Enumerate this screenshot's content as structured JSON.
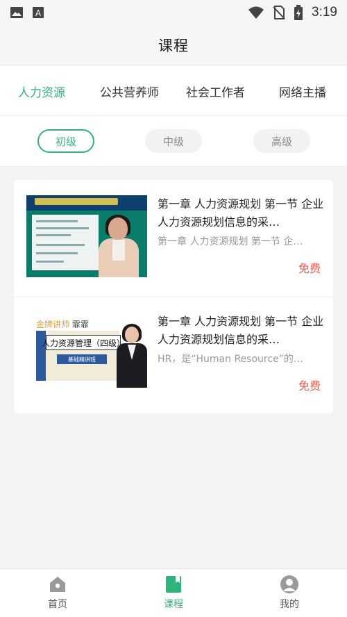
{
  "status_bar": {
    "time": "3:19",
    "left_icons": [
      "image-icon",
      "font-a-icon"
    ],
    "right_icons": [
      "wifi-icon",
      "no-sim-icon",
      "battery-charging-icon"
    ]
  },
  "header": {
    "title": "课程"
  },
  "categories": [
    {
      "label": "人力资源",
      "active": true
    },
    {
      "label": "公共营养师",
      "active": false
    },
    {
      "label": "社会工作者",
      "active": false
    },
    {
      "label": "网络主播",
      "active": false
    }
  ],
  "levels": [
    {
      "label": "初级",
      "active": true
    },
    {
      "label": "中级",
      "active": false
    },
    {
      "label": "高级",
      "active": false
    }
  ],
  "courses": [
    {
      "title": "第一章 人力资源规划 第一节 企业人力资源规划信息的采…",
      "description": "第一章 人力资源规划 第一节 企…",
      "price": "免费",
      "thumbnail": "classroom-video-thumbnail"
    },
    {
      "title": "第一章 人力资源规划 第一节 企业人力资源规划信息的采…",
      "description": "HR，是“Human Resource”的…",
      "price": "免费",
      "thumbnail": "course-poster-thumbnail",
      "poster": {
        "brand": "金牌讲师",
        "teacher": "霏霏",
        "book_title": "人力资源管理（四级）",
        "tag": "基础精讲班"
      }
    }
  ],
  "bottom_nav": [
    {
      "label": "首页",
      "icon": "home-icon",
      "active": false
    },
    {
      "label": "课程",
      "icon": "book-icon",
      "active": true
    },
    {
      "label": "我的",
      "icon": "profile-icon",
      "active": false
    }
  ],
  "colors": {
    "accent": "#2fb37c",
    "price": "#f05a4a",
    "background": "#f3f3f5"
  }
}
